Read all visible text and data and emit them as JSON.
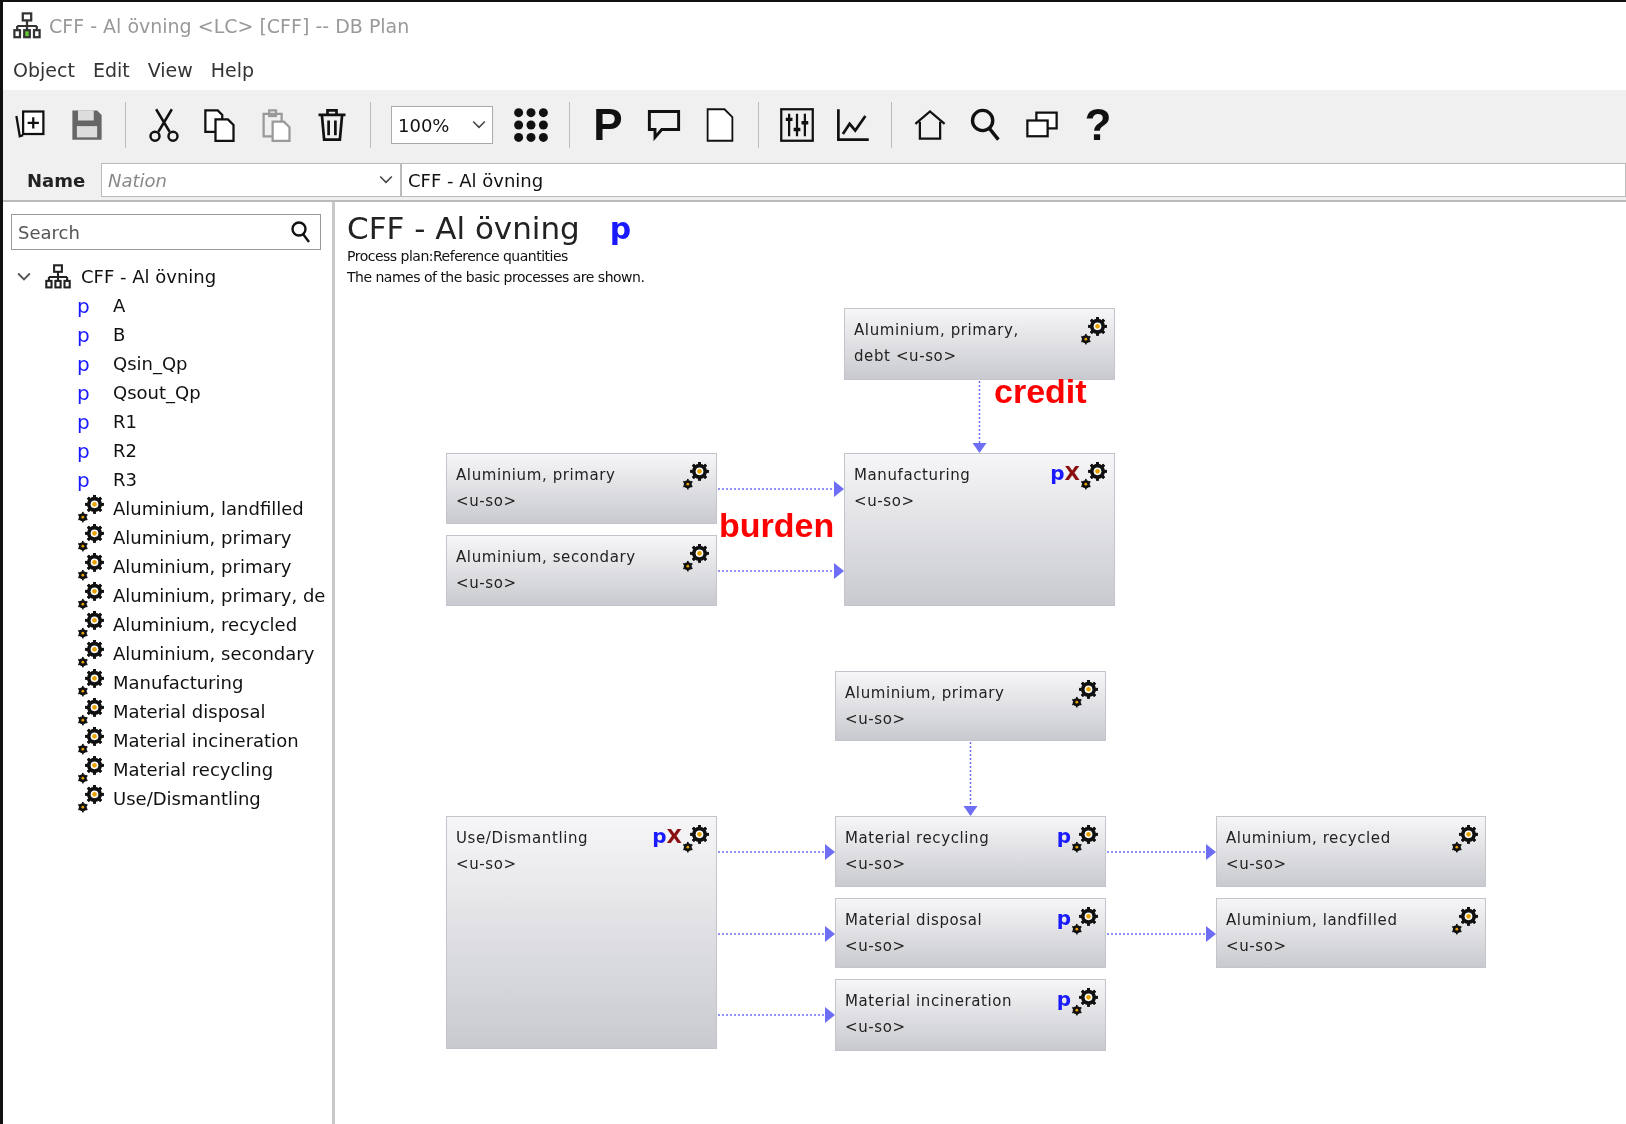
{
  "window": {
    "title": "CFF - Al övning <LC> [CFF] -- DB Plan"
  },
  "menu": [
    "Object",
    "Edit",
    "View",
    "Help"
  ],
  "toolbar": [
    {
      "kind": "new"
    },
    {
      "kind": "save"
    },
    {
      "kind": "separator"
    },
    {
      "kind": "cut"
    },
    {
      "kind": "copy"
    },
    {
      "kind": "paste"
    },
    {
      "kind": "delete"
    },
    {
      "kind": "separator"
    },
    {
      "kind": "zoom",
      "value": "100%"
    },
    {
      "kind": "grid"
    },
    {
      "kind": "separator"
    },
    {
      "kind": "glyph",
      "text": "P"
    },
    {
      "kind": "comment"
    },
    {
      "kind": "page"
    },
    {
      "kind": "separator"
    },
    {
      "kind": "sliders"
    },
    {
      "kind": "chart"
    },
    {
      "kind": "separator"
    },
    {
      "kind": "home"
    },
    {
      "kind": "search"
    },
    {
      "kind": "windows"
    },
    {
      "kind": "glyph",
      "text": "?"
    }
  ],
  "name_row": {
    "label": "Name",
    "type_placeholder": "Nation",
    "value": "CFF - Al övning"
  },
  "sidebar": {
    "search": {
      "placeholder": "Search"
    },
    "tree": {
      "label": "CFF - Al övning",
      "expanded": true,
      "children": [
        {
          "kind": "parameter",
          "marker": "p",
          "label": "A"
        },
        {
          "kind": "parameter",
          "marker": "p",
          "label": "B"
        },
        {
          "kind": "parameter",
          "marker": "p",
          "label": "Qsin_Qp"
        },
        {
          "kind": "parameter",
          "marker": "p",
          "label": "Qsout_Qp"
        },
        {
          "kind": "parameter",
          "marker": "p",
          "label": "R1"
        },
        {
          "kind": "parameter",
          "marker": "p",
          "label": "R2"
        },
        {
          "kind": "parameter",
          "marker": "p",
          "label": "R3"
        },
        {
          "kind": "process",
          "label": "Aluminium, landfilled"
        },
        {
          "kind": "process",
          "label": "Aluminium, primary"
        },
        {
          "kind": "process",
          "label": "Aluminium, primary"
        },
        {
          "kind": "process",
          "label": "Aluminium, primary, de"
        },
        {
          "kind": "process",
          "label": "Aluminium, recycled"
        },
        {
          "kind": "process",
          "label": "Aluminium, secondary"
        },
        {
          "kind": "process",
          "label": "Manufacturing"
        },
        {
          "kind": "process",
          "label": "Material disposal"
        },
        {
          "kind": "process",
          "label": "Material incineration"
        },
        {
          "kind": "process",
          "label": "Material recycling"
        },
        {
          "kind": "process",
          "label": "Use/Dismantling"
        }
      ]
    }
  },
  "plan": {
    "title": "CFF - Al övning",
    "title_marker": "p",
    "description": [
      "Process plan:Reference quantities",
      "The names of the basic processes are shown."
    ],
    "nodes": [
      {
        "lines": [
          "Aluminium, primary,",
          "debt <u-so>"
        ]
      },
      {
        "lines": [
          "Aluminium, primary",
          "<u-so>"
        ]
      },
      {
        "lines": [
          "Manufacturing",
          "<u-so>"
        ],
        "marks": [
          "p",
          "X"
        ]
      },
      {
        "lines": [
          "Aluminium, secondary",
          "<u-so>"
        ]
      },
      {
        "lines": [
          "Aluminium, primary",
          "<u-so>"
        ]
      },
      {
        "lines": [
          "Use/Dismantling",
          "<u-so>"
        ],
        "marks": [
          "p",
          "X"
        ]
      },
      {
        "lines": [
          "Material recycling",
          "<u-so>"
        ],
        "marks": [
          "p"
        ]
      },
      {
        "lines": [
          "Aluminium, recycled",
          "<u-so>"
        ]
      },
      {
        "lines": [
          "Material disposal",
          "<u-so>"
        ],
        "marks": [
          "p"
        ]
      },
      {
        "lines": [
          "Aluminium, landfilled",
          "<u-so>"
        ]
      },
      {
        "lines": [
          "Material incineration",
          "<u-so>"
        ],
        "marks": [
          "p"
        ]
      }
    ],
    "annotations": [
      "credit",
      "burden"
    ]
  }
}
